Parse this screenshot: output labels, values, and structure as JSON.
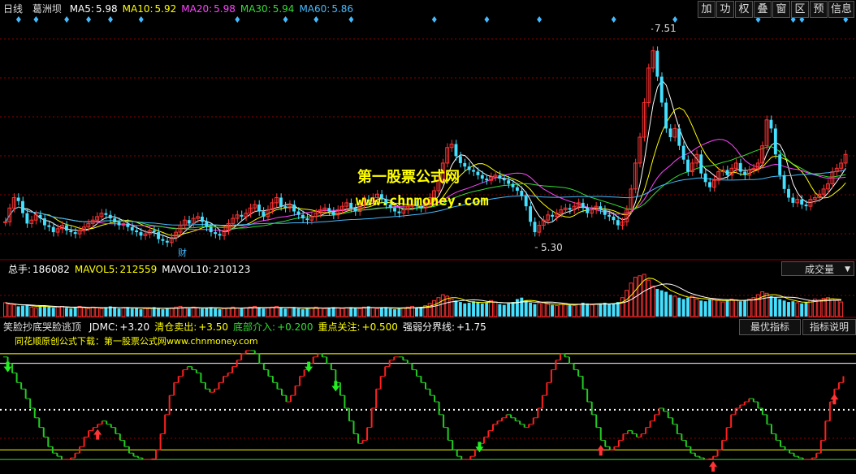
{
  "header": {
    "period": "日线",
    "stock_name": "葛洲坝",
    "ma": [
      {
        "label": "MA5:",
        "value": "5.98",
        "color": "#ffffff"
      },
      {
        "label": "MA10:",
        "value": "5.92",
        "color": "#ffff00"
      },
      {
        "label": "MA20:",
        "value": "5.98",
        "color": "#ff44ff"
      },
      {
        "label": "MA30:",
        "value": "5.94",
        "color": "#33dd33"
      },
      {
        "label": "MA60:",
        "value": "5.86",
        "color": "#44bbff"
      }
    ]
  },
  "toolbar": {
    "buttons": [
      "加",
      "功",
      "权",
      "叠",
      "窗",
      "区",
      "预",
      "信息"
    ]
  },
  "price_panel": {
    "high_label": "7.51",
    "low_label": "5.30",
    "event_label": "财"
  },
  "watermark": {
    "line1": "第一股票公式网",
    "line2": "www.chnmoney.com"
  },
  "volume_panel": {
    "items": [
      {
        "label": "总手:",
        "value": "186082",
        "color": "#ffffff"
      },
      {
        "label": "MAVOL5:",
        "value": "212559",
        "color": "#ffff00"
      },
      {
        "label": "MAVOL10:",
        "value": "210123",
        "color": "#ffffff"
      }
    ],
    "selector": "成交量"
  },
  "indicator_panel": {
    "title": "笑脸抄底哭脸逃顶",
    "params": [
      {
        "label": "JDMC:",
        "value": "+3.20",
        "color": "#ffffff"
      },
      {
        "label": "清仓卖出:",
        "value": "+3.50",
        "color": "#ffff00"
      },
      {
        "label": "底部介入:",
        "value": "+0.200",
        "color": "#33dd33"
      },
      {
        "label": "重点关注:",
        "value": "+0.500",
        "color": "#ffff00"
      },
      {
        "label": "强弱分界线:",
        "value": "+1.75",
        "color": "#ffffff"
      }
    ],
    "buttons": [
      "最优指标",
      "指标说明"
    ],
    "note": "同花顺原创公式下载：第一股票公式网www.chnmoney.com"
  },
  "colors": {
    "up": "#ff3333",
    "down": "#44e0ff",
    "grid": "#8b0000",
    "indicator_up": "#ff2020",
    "indicator_down": "#22cc22"
  },
  "price_series": [
    5.42,
    5.58,
    5.7,
    5.66,
    5.52,
    5.4,
    5.44,
    5.5,
    5.46,
    5.38,
    5.36,
    5.3,
    5.34,
    5.38,
    5.32,
    5.3,
    5.28,
    5.32,
    5.36,
    5.4,
    5.44,
    5.48,
    5.52,
    5.5,
    5.46,
    5.42,
    5.38,
    5.4,
    5.36,
    5.32,
    5.3,
    5.26,
    5.28,
    5.32,
    5.3,
    5.22,
    5.2,
    5.18,
    5.24,
    5.3,
    5.38,
    5.44,
    5.4,
    5.46,
    5.48,
    5.42,
    5.36,
    5.3,
    5.28,
    5.26,
    5.32,
    5.4,
    5.46,
    5.5,
    5.48,
    5.52,
    5.58,
    5.62,
    5.54,
    5.48,
    5.56,
    5.64,
    5.7,
    5.6,
    5.58,
    5.62,
    5.54,
    5.5,
    5.46,
    5.44,
    5.48,
    5.52,
    5.56,
    5.58,
    5.54,
    5.5,
    5.56,
    5.6,
    5.64,
    5.58,
    5.54,
    5.62,
    5.68,
    5.66,
    5.7,
    5.74,
    5.68,
    5.62,
    5.58,
    5.54,
    5.52,
    5.56,
    5.6,
    5.62,
    5.6,
    5.58,
    5.64,
    5.7,
    5.78,
    5.9,
    6.1,
    6.28,
    6.32,
    6.18,
    6.1,
    6.06,
    6.02,
    6.0,
    5.96,
    5.92,
    5.9,
    5.94,
    5.96,
    5.92,
    5.9,
    5.86,
    5.82,
    5.78,
    5.72,
    5.6,
    5.42,
    5.3,
    5.38,
    5.44,
    5.5,
    5.48,
    5.52,
    5.56,
    5.58,
    5.56,
    5.6,
    5.64,
    5.58,
    5.52,
    5.56,
    5.6,
    5.56,
    5.5,
    5.48,
    5.44,
    5.38,
    5.42,
    5.56,
    5.8,
    6.1,
    6.4,
    6.8,
    7.2,
    7.4,
    7.1,
    6.8,
    6.5,
    6.4,
    6.5,
    6.3,
    6.14,
    6.0,
    6.1,
    6.2,
    5.98,
    5.88,
    5.82,
    5.9,
    6.0,
    6.02,
    5.96,
    6.04,
    6.1,
    6.0,
    5.96,
    6.02,
    6.04,
    6.1,
    6.3,
    6.6,
    6.5,
    6.2,
    5.96,
    5.8,
    5.7,
    5.64,
    5.68,
    5.62,
    5.6,
    5.68,
    5.7,
    5.74,
    5.8,
    5.86,
    6.0,
    6.04,
    6.1,
    6.2
  ],
  "volume_series": [
    1.9,
    1.7,
    1.6,
    1.4,
    1.5,
    1.6,
    1.3,
    1.2,
    1.4,
    1.5,
    1.3,
    1.2,
    1.3,
    1.4,
    1.2,
    1.1,
    1.3,
    1.4,
    1.2,
    1.1,
    1.3,
    1.2,
    1.1,
    1.3,
    1.4,
    1.2,
    1.1,
    1.2,
    1.3,
    1.1,
    1.2,
    1.0,
    1.1,
    1.2,
    1.3,
    1.1,
    1.0,
    1.1,
    1.2,
    1.3,
    1.4,
    1.2,
    1.1,
    1.3,
    1.2,
    1.1,
    1.2,
    1.3,
    1.1,
    1.0,
    1.1,
    1.2,
    1.3,
    1.2,
    1.1,
    1.2,
    1.3,
    1.4,
    1.2,
    1.1,
    1.2,
    1.3,
    1.4,
    1.2,
    1.1,
    1.2,
    1.3,
    1.1,
    1.0,
    1.1,
    1.2,
    1.3,
    1.2,
    1.1,
    1.2,
    1.3,
    1.2,
    1.1,
    1.2,
    1.3,
    1.2,
    1.1,
    1.3,
    1.4,
    1.2,
    1.1,
    1.2,
    1.3,
    1.1,
    1.0,
    1.1,
    1.2,
    1.3,
    1.4,
    1.2,
    1.3,
    1.5,
    1.8,
    2.2,
    2.6,
    3.0,
    2.8,
    2.4,
    2.2,
    2.0,
    1.8,
    1.9,
    2.1,
    2.0,
    1.8,
    1.9,
    2.2,
    2.0,
    1.7,
    1.6,
    1.8,
    2.0,
    2.4,
    2.6,
    2.2,
    1.9,
    1.7,
    1.8,
    1.9,
    1.7,
    1.6,
    1.5,
    1.7,
    1.8,
    1.6,
    1.5,
    1.7,
    1.9,
    1.8,
    1.6,
    1.7,
    1.8,
    1.9,
    1.7,
    1.8,
    2.0,
    2.6,
    3.6,
    4.6,
    5.4,
    5.6,
    5.8,
    5.0,
    4.2,
    3.8,
    3.6,
    3.4,
    3.0,
    2.8,
    2.6,
    2.4,
    2.6,
    2.8,
    2.4,
    2.2,
    2.1,
    2.3,
    2.4,
    2.2,
    2.0,
    2.2,
    2.4,
    2.3,
    2.1,
    2.2,
    2.4,
    2.6,
    3.0,
    3.4,
    3.2,
    2.8,
    2.6,
    2.4,
    2.2,
    2.0,
    2.1,
    1.9,
    1.8,
    2.0,
    2.2,
    2.4,
    2.3,
    2.5,
    2.6,
    2.4,
    2.2,
    2.0
  ],
  "indicator_series": [
    3.4,
    3.2,
    2.9,
    2.6,
    2.4,
    2.1,
    1.8,
    1.5,
    1.2,
    0.9,
    0.6,
    0.4,
    0.3,
    0.2,
    0.2,
    0.25,
    0.4,
    0.6,
    0.9,
    1.1,
    1.2,
    1.3,
    1.4,
    1.3,
    1.2,
    1.0,
    0.8,
    0.6,
    0.4,
    0.3,
    0.25,
    0.2,
    0.2,
    0.22,
    0.5,
    1.0,
    1.6,
    2.2,
    2.6,
    2.8,
    3.0,
    3.1,
    3.0,
    2.9,
    2.6,
    2.4,
    2.3,
    2.4,
    2.6,
    2.8,
    2.9,
    3.1,
    3.3,
    3.5,
    3.6,
    3.6,
    3.5,
    3.2,
    3.0,
    2.8,
    2.6,
    2.4,
    2.2,
    2.0,
    2.2,
    2.5,
    2.8,
    3.0,
    3.2,
    3.4,
    3.5,
    3.4,
    3.2,
    3.0,
    2.6,
    2.2,
    1.8,
    1.4,
    1.0,
    0.7,
    0.8,
    1.2,
    1.8,
    2.4,
    2.8,
    3.1,
    3.3,
    3.4,
    3.4,
    3.3,
    3.2,
    3.0,
    2.8,
    2.6,
    2.4,
    2.2,
    2.0,
    1.6,
    1.2,
    0.8,
    0.5,
    0.3,
    0.2,
    0.2,
    0.3,
    0.5,
    0.7,
    0.9,
    1.1,
    1.3,
    1.4,
    1.5,
    1.6,
    1.5,
    1.4,
    1.3,
    1.2,
    1.3,
    1.5,
    1.8,
    2.2,
    2.6,
    3.0,
    3.3,
    3.5,
    3.4,
    3.2,
    3.0,
    2.8,
    2.4,
    2.0,
    1.6,
    1.2,
    0.8,
    0.6,
    0.5,
    0.6,
    0.8,
    1.0,
    1.1,
    1.0,
    0.9,
    1.0,
    1.2,
    1.4,
    1.6,
    1.8,
    1.7,
    1.5,
    1.3,
    1.0,
    0.8,
    0.6,
    0.4,
    0.3,
    0.25,
    0.2,
    0.22,
    0.3,
    0.5,
    0.8,
    1.2,
    1.6,
    1.8,
    1.9,
    2.0,
    2.1,
    2.0,
    1.8,
    1.6,
    1.3,
    1.0,
    0.8,
    0.6,
    0.5,
    0.4,
    0.3,
    0.25,
    0.2,
    0.2,
    0.25,
    0.4,
    0.8,
    1.4,
    2.0,
    2.4,
    2.6,
    2.8
  ],
  "markers": {
    "buy": [
      21,
      133,
      158,
      185
    ],
    "sell": [
      1,
      68,
      74,
      106
    ]
  },
  "axis": {
    "price_min": 5.0,
    "price_max": 7.8,
    "indicator_min": 0,
    "indicator_max": 3.8
  }
}
